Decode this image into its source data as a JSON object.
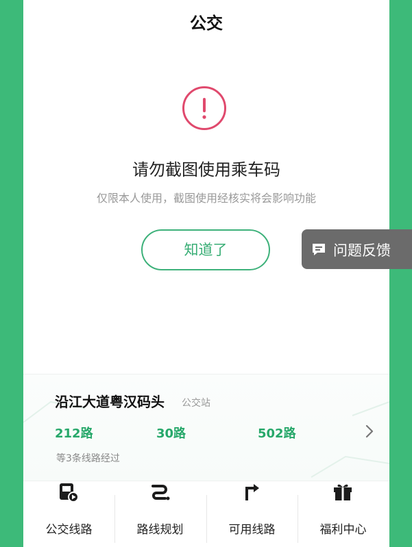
{
  "header": {
    "title": "公交"
  },
  "dialog": {
    "icon": "exclamation-circle-icon",
    "accent_color": "#e0496d",
    "heading": "请勿截图使用乘车码",
    "subtext": "仅限本人使用，截图使用经核实将会影响功能",
    "ok_label": "知道了",
    "button_color": "#3db17a"
  },
  "feedback": {
    "label": "问题反馈",
    "icon": "feedback-icon"
  },
  "station": {
    "name": "沿江大道粤汉码头",
    "type": "公交站",
    "routes": [
      "212路",
      "30路",
      "502路"
    ],
    "passing_text": "等3条线路经过",
    "route_color": "#27a86a"
  },
  "bottom_nav": {
    "items": [
      {
        "label": "公交线路",
        "icon": "bus-route-icon"
      },
      {
        "label": "路线规划",
        "icon": "route-planning-icon"
      },
      {
        "label": "可用线路",
        "icon": "available-lines-icon"
      },
      {
        "label": "福利中心",
        "icon": "gift-icon"
      }
    ]
  },
  "theme": {
    "background": "#3dba79"
  }
}
